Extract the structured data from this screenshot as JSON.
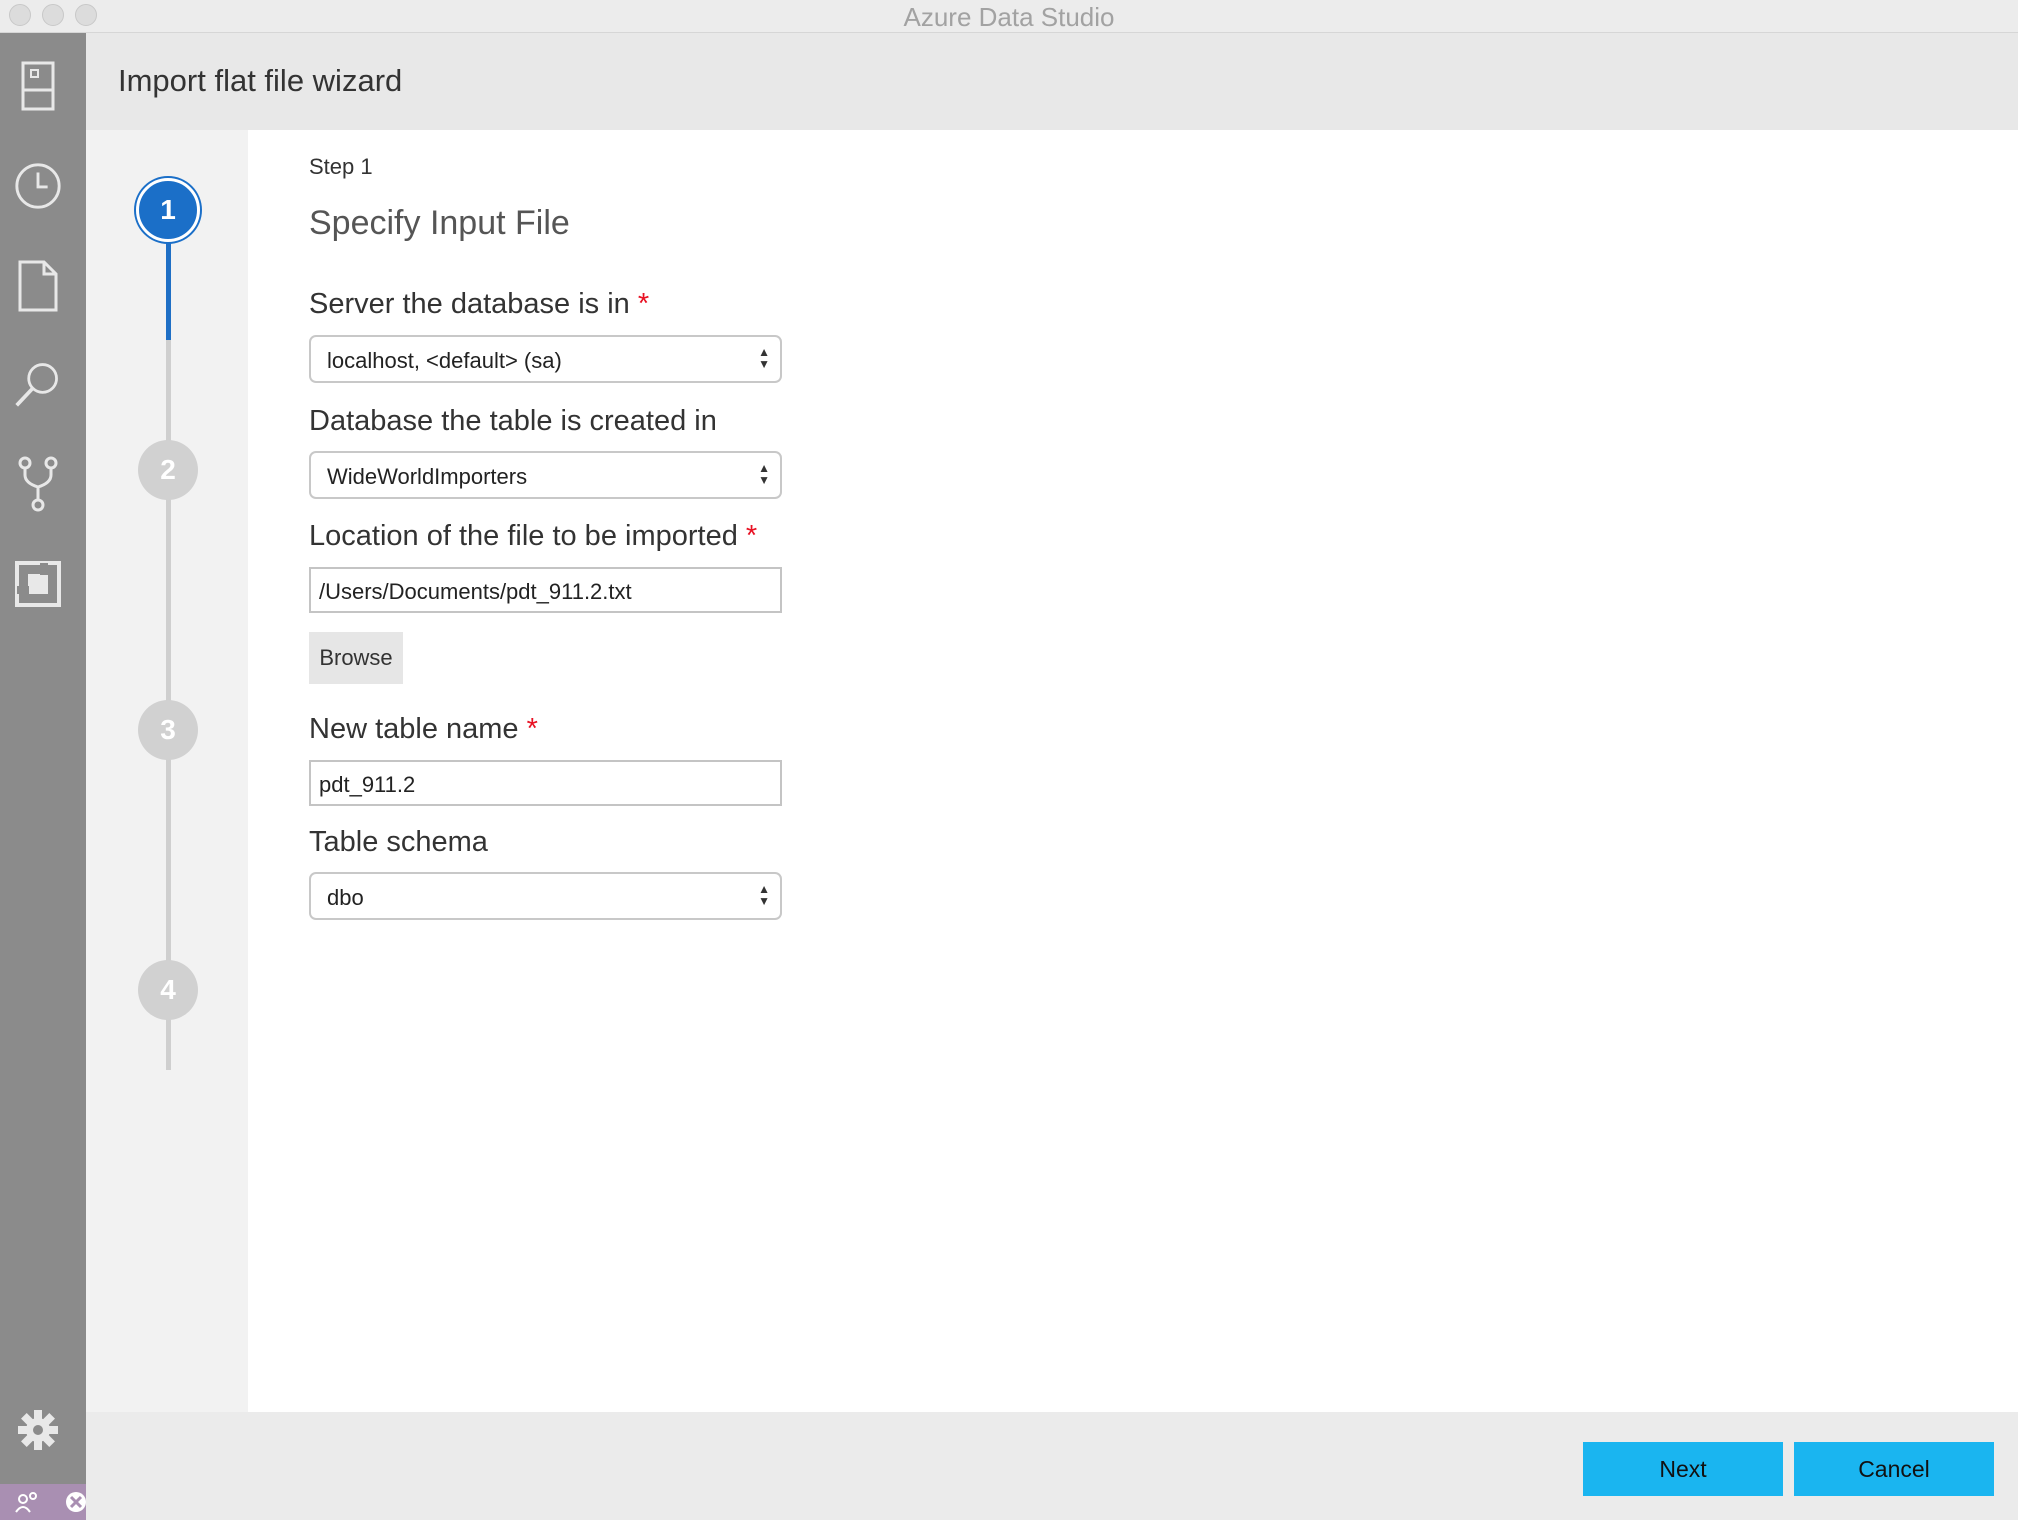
{
  "window": {
    "title": "Azure Data Studio"
  },
  "activity_bar": {
    "icons": [
      "servers-icon",
      "history-icon",
      "file-icon",
      "search-icon",
      "source-control-icon",
      "extensions-icon",
      "settings-gear-icon",
      "live-share-icon"
    ]
  },
  "header": {
    "title": "Import flat file wizard"
  },
  "steps": {
    "items": [
      "1",
      "2",
      "3",
      "4"
    ],
    "active": 1,
    "active_color": "#1b6fc8"
  },
  "form": {
    "step_label": "Step 1",
    "step_title": "Specify Input File",
    "server_label": "Server the database is in",
    "server_value": "localhost, <default> (sa)",
    "database_label": "Database the table is created in",
    "database_value": "WideWorldImporters",
    "location_label": "Location of the file to be imported",
    "location_value": "/Users/Documents/pdt_911.2.txt",
    "browse_label": "Browse",
    "table_name_label": "New table name",
    "table_name_value": "pdt_911.2",
    "schema_label": "Table schema",
    "schema_value": "dbo",
    "required_marker": "*"
  },
  "footer": {
    "next_label": "Next",
    "cancel_label": "Cancel",
    "button_color": "#1ab5f0"
  }
}
